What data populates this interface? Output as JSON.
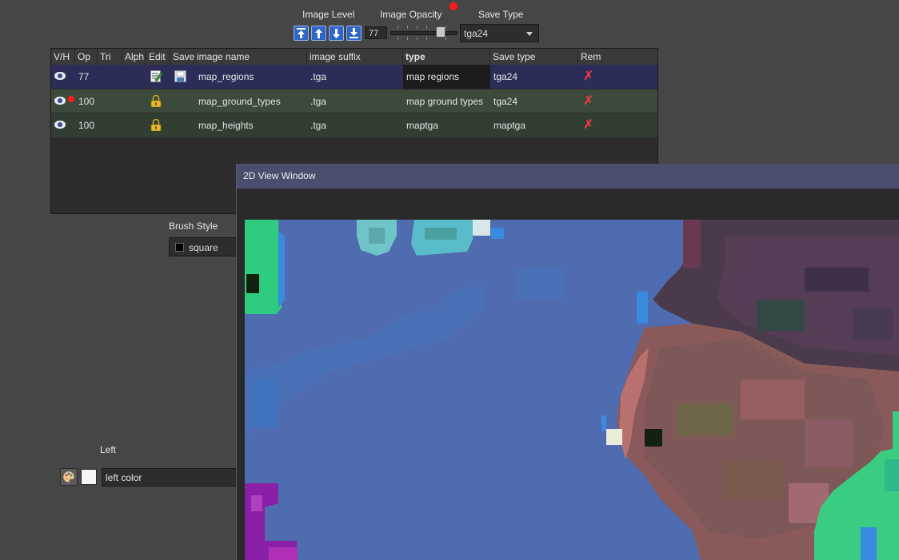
{
  "toolbar": {
    "image_level_label": "Image Level",
    "image_opacity_label": "Image Opacity",
    "save_type_label": "Save Type",
    "opacity_value": "77",
    "opacity_fraction": 0.77,
    "save_type_value": "tga24"
  },
  "table": {
    "headers": [
      "V/H",
      "Op",
      "Tri",
      "Alph",
      "Edit",
      "Save",
      "image name",
      "image suffix",
      "type",
      "Save type",
      "Rem"
    ],
    "rows": [
      {
        "op": "77",
        "name": "map_regions",
        "suffix": ".tga",
        "type": "map regions",
        "save_type": "tga24"
      },
      {
        "op": "100",
        "name": "map_ground_types",
        "suffix": ".tga",
        "type": "map ground types",
        "save_type": "tga24"
      },
      {
        "op": "100",
        "name": "map_heights",
        "suffix": ".tga",
        "type": "maptga",
        "save_type": "maptga"
      }
    ]
  },
  "brush": {
    "label": "Brush Style",
    "value": "square"
  },
  "left_color": {
    "label": "Left",
    "field_value": "left color"
  },
  "view_window": {
    "title": "2D View Window"
  },
  "colors": {
    "water": "#506cb0",
    "selected_row": "#2b2d55",
    "green_row": "#3a4a3a",
    "accent_red": "#ff2020"
  }
}
